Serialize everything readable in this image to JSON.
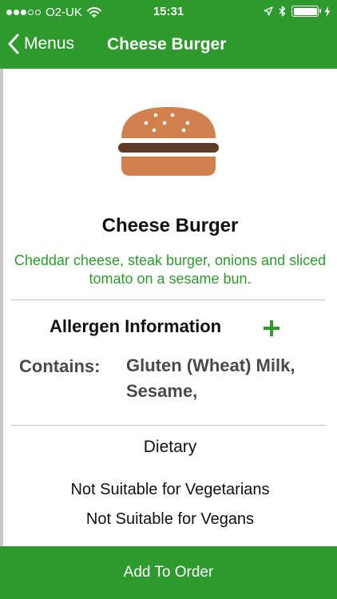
{
  "status_bar": {
    "carrier": "O2-UK",
    "time": "15:31",
    "signal_bars_filled": 3,
    "signal_bars_total": 5,
    "icons": [
      "wifi-icon",
      "location-arrow-icon",
      "bluetooth-icon",
      "battery-icon",
      "charging-icon"
    ]
  },
  "nav": {
    "back_label": "Menus",
    "title": "Cheese Burger"
  },
  "item": {
    "icon": "burger-icon",
    "name": "Cheese Burger",
    "description": "Cheddar cheese, steak burger, onions and sliced tomato on a sesame bun."
  },
  "allergens": {
    "heading": "Allergen Information",
    "expand_icon": "plus-icon",
    "contains_label": "Contains:",
    "contains_values": "Gluten (Wheat) Milk, Sesame,"
  },
  "dietary": {
    "heading": "Dietary",
    "items": [
      "Not Suitable for Vegetarians",
      "Not Suitable for Vegans"
    ]
  },
  "footer": {
    "add_label": "Add To Order"
  },
  "colors": {
    "brand_green": "#2e9a2e",
    "bun": "#d2804e",
    "patty": "#5e3b27"
  }
}
